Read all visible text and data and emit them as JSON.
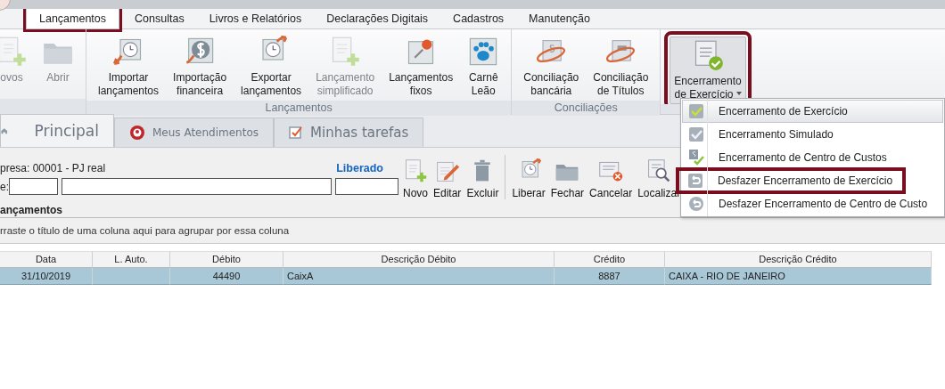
{
  "menu_tabs": [
    {
      "label": "Lançamentos",
      "selected": true,
      "highlighted": true
    },
    {
      "label": "Consultas",
      "selected": false,
      "highlighted": false
    },
    {
      "label": "Livros e Relatórios",
      "selected": false,
      "highlighted": false
    },
    {
      "label": "Declarações Digitais",
      "selected": false,
      "highlighted": false
    },
    {
      "label": "Cadastros",
      "selected": false,
      "highlighted": false
    },
    {
      "label": "Manutenção",
      "selected": false,
      "highlighted": false
    }
  ],
  "ribbon": {
    "groups": [
      {
        "buttons": [
          {
            "lines": [
              "ovos"
            ],
            "kind": "doc-plus",
            "disabled": true
          },
          {
            "lines": [
              "Abrir"
            ],
            "kind": "folder",
            "disabled": true
          }
        ]
      },
      {
        "label": "Lançamentos",
        "buttons": [
          {
            "lines": [
              "Importar",
              "lançamentos"
            ],
            "kind": "clock-import",
            "disabled": false
          },
          {
            "lines": [
              "Importação",
              "financeira"
            ],
            "kind": "dollar-import",
            "disabled": false
          },
          {
            "lines": [
              "Exportar",
              "lançamentos"
            ],
            "kind": "clock-export",
            "disabled": false
          },
          {
            "lines": [
              "Lançamento",
              "simplificado"
            ],
            "kind": "doc-plus",
            "disabled": true
          },
          {
            "lines": [
              "Lançamentos",
              "fixos"
            ],
            "kind": "pin",
            "disabled": false
          },
          {
            "lines": [
              "Carnê",
              "Leão"
            ],
            "kind": "paw",
            "disabled": false
          }
        ]
      },
      {
        "label": "Conciliações",
        "buttons": [
          {
            "lines": [
              "Conciliação",
              "bancária"
            ],
            "kind": "dollar-orbit",
            "disabled": false
          },
          {
            "lines": [
              "Conciliação",
              "de Títulos"
            ],
            "kind": "chat-orbit",
            "disabled": false
          }
        ]
      },
      {
        "buttons": [
          {
            "lines": [
              "Encerramento",
              "de Exercício"
            ],
            "kind": "doc-check",
            "disabled": false,
            "dropdown": true,
            "pressed": true,
            "highlighted": true
          }
        ]
      }
    ]
  },
  "dropdown": [
    {
      "label": "Encerramento de Exercício",
      "kind": "check",
      "selected": true,
      "highlighted": false,
      "separator_before": false
    },
    {
      "label": "Encerramento Simulado",
      "kind": "check-gray",
      "selected": false,
      "highlighted": false,
      "separator_before": false
    },
    {
      "label": "Encerramento de Centro de Custos",
      "kind": "dollar-check",
      "selected": false,
      "highlighted": false,
      "separator_before": false
    },
    {
      "label": "Desfazer Encerramento de Exercício",
      "kind": "undo-square",
      "selected": false,
      "highlighted": true,
      "separator_before": true
    },
    {
      "label": "Desfazer Encerramento de Centro de Custo",
      "kind": "undo-circle",
      "selected": false,
      "highlighted": false,
      "separator_before": false
    }
  ],
  "doc_tabs": [
    {
      "label": "Principal",
      "kind": "home",
      "selected": true
    },
    {
      "label": "Meus Atendimentos",
      "kind": "support",
      "selected": false
    },
    {
      "label": "Minhas tarefas",
      "kind": "task",
      "selected": false
    }
  ],
  "toolbar": {
    "company": "presa: 00001 - PJ real",
    "status": "Liberado",
    "field_label": "e:",
    "buttons": [
      {
        "label": "Novo",
        "kind": "doc-plus"
      },
      {
        "label": "Editar",
        "kind": "pencil"
      },
      {
        "label": "Excluir",
        "kind": "trash"
      },
      {
        "label": "Liberar",
        "kind": "clock-export"
      },
      {
        "label": "Fechar",
        "kind": "folder"
      },
      {
        "label": "Cancelar",
        "kind": "doc-x"
      },
      {
        "label": "Localizar",
        "kind": "doc-search"
      }
    ]
  },
  "grid": {
    "title": "ançamentos",
    "group_hint": "rraste o título de uma coluna aqui para agrupar por essa coluna",
    "columns": [
      "Data",
      "L. Auto.",
      "Débito",
      "Descrição Débito",
      "Crédito",
      "Descrição Crédito"
    ],
    "rows": [
      {
        "selected": true,
        "cells": [
          "31/10/2019",
          "",
          "44490",
          "CaixA",
          "8887",
          "CAIXA - RIO DE JANEIRO"
        ]
      }
    ]
  }
}
